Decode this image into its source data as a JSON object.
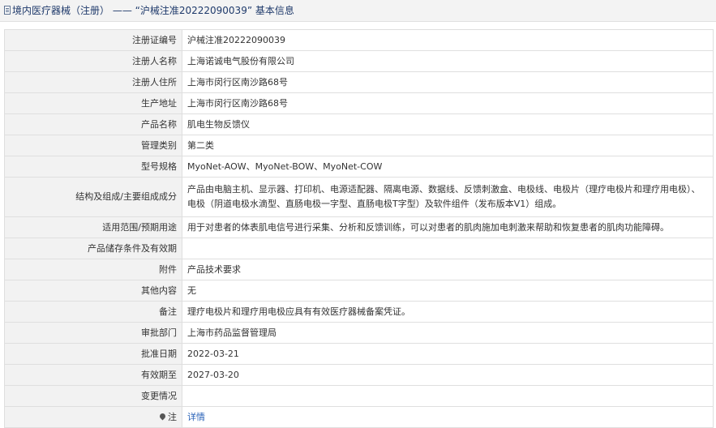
{
  "header": {
    "title": "境内医疗器械（注册） —— “沪械注准20222090039” 基本信息"
  },
  "rows": [
    {
      "label": "注册证编号",
      "value": "沪械注准20222090039"
    },
    {
      "label": "注册人名称",
      "value": "上海诺诚电气股份有限公司"
    },
    {
      "label": "注册人住所",
      "value": "上海市闵行区南沙路68号"
    },
    {
      "label": "生产地址",
      "value": "上海市闵行区南沙路68号"
    },
    {
      "label": "产品名称",
      "value": "肌电生物反馈仪"
    },
    {
      "label": "管理类别",
      "value": "第二类"
    },
    {
      "label": "型号规格",
      "value": "MyoNet-AOW、MyoNet-BOW、MyoNet-COW"
    },
    {
      "label": "结构及组成/主要组成成分",
      "value": "产品由电脑主机、显示器、打印机、电源适配器、隔离电源、数据线、反馈刺激盒、电极线、电极片（理疗电极片和理疗用电极）、电极（阴道电极水滴型、直肠电极一字型、直肠电极T字型）及软件组件（发布版本V1）组成。"
    },
    {
      "label": "适用范围/预期用途",
      "value": "用于对患者的体表肌电信号进行采集、分析和反馈训练，可以对患者的肌肉施加电刺激来帮助和恢复患者的肌肉功能障碍。"
    },
    {
      "label": "产品储存条件及有效期",
      "value": ""
    },
    {
      "label": "附件",
      "value": "产品技术要求"
    },
    {
      "label": "其他内容",
      "value": "无"
    },
    {
      "label": "备注",
      "value": "理疗电极片和理疗用电极应具有有效医疗器械备案凭证。"
    },
    {
      "label": "审批部门",
      "value": "上海市药品监督管理局"
    },
    {
      "label": "批准日期",
      "value": "2022-03-21"
    },
    {
      "label": "有效期至",
      "value": "2027-03-20"
    },
    {
      "label": "变更情况",
      "value": ""
    },
    {
      "label": "注",
      "value": "详情"
    }
  ]
}
